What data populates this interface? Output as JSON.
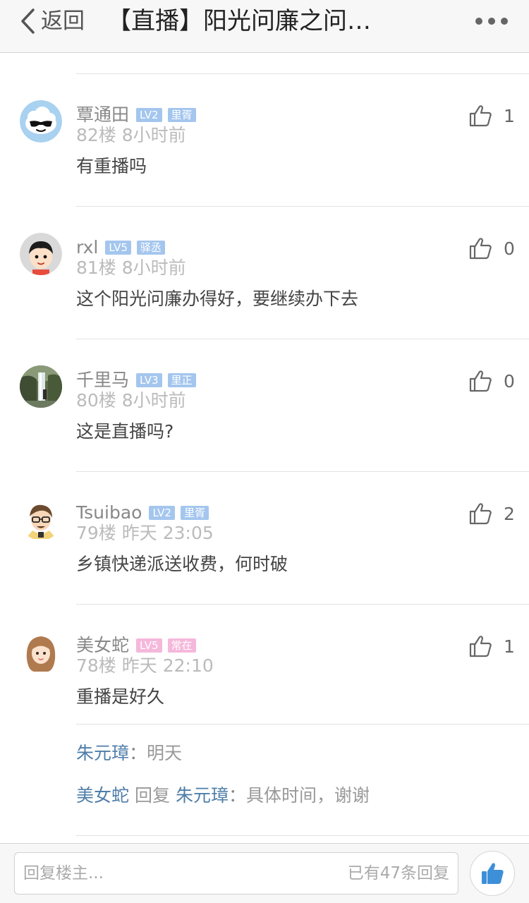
{
  "header": {
    "back_label": "返回",
    "title": "【直播】阳光问廉之问…",
    "more_icon": "more-dots-icon"
  },
  "comments": [
    {
      "username": "覃通田",
      "level": "LV2",
      "rank": "里胥",
      "badge_color": "#a4c6ee",
      "floor": "82楼",
      "time": "8小时前",
      "text": "有重播吗",
      "likes": "1",
      "avatar_icon": "cloud-sunglasses-avatar"
    },
    {
      "username": "rxl",
      "level": "LV5",
      "rank": "驿丞",
      "badge_color": "#a4c6ee",
      "floor": "81楼",
      "time": "8小时前",
      "text": "这个阳光问廉办得好，要继续办下去",
      "likes": "0",
      "avatar_icon": "cartoon-boy-avatar"
    },
    {
      "username": "千里马",
      "level": "LV3",
      "rank": "里正",
      "badge_color": "#a4c6ee",
      "floor": "80楼",
      "time": "8小时前",
      "text": "这是直播吗?",
      "likes": "0",
      "avatar_icon": "waterfall-photo-avatar"
    },
    {
      "username": "Tsuibao",
      "level": "LV2",
      "rank": "里胥",
      "badge_color": "#a4c6ee",
      "floor": "79楼",
      "time": "昨天 23:05",
      "text": "乡镇快递派送收费，何时破",
      "likes": "2",
      "avatar_icon": "cartoon-man-avatar"
    },
    {
      "username": "美女蛇",
      "level": "LV5",
      "rank": "常在",
      "badge_color": "#f5b8db",
      "floor": "78楼",
      "time": "昨天 22:10",
      "text": "重播是好久",
      "likes": "1",
      "avatar_icon": "cartoon-girl-avatar",
      "replies": [
        {
          "from": "朱元璋",
          "verb": "",
          "to": "",
          "sep": "：",
          "text": "明天"
        },
        {
          "from": "美女蛇",
          "verb": "回复",
          "to": "朱元璋",
          "sep": "：",
          "text": "具体时间，谢谢"
        }
      ]
    }
  ],
  "bottom": {
    "placeholder": "回复楼主...",
    "reply_count": "已有47条回复"
  },
  "colors": {
    "link_blue": "#4f7ea8",
    "badge_blue": "#a4c6ee",
    "badge_pink": "#f5b8db",
    "like_fab": "#3d8fd8"
  }
}
